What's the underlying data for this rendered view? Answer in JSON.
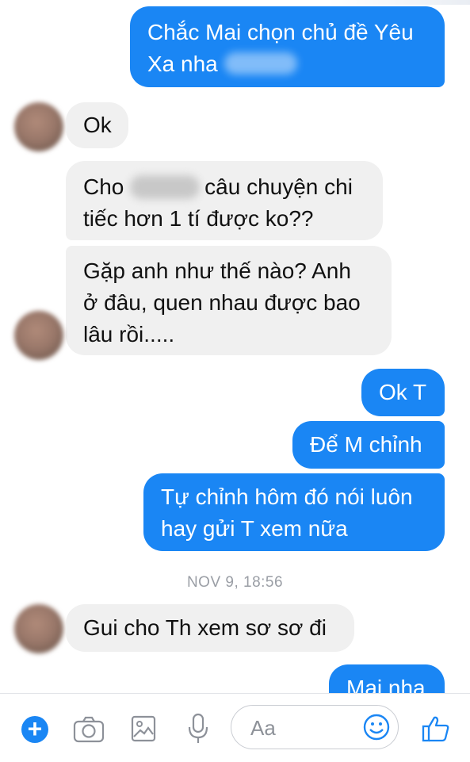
{
  "messages": [
    {
      "from": "me",
      "lines": [
        "Chắc Mai chọn chủ đề Yêu",
        "Xa nha"
      ]
    },
    {
      "from": "them",
      "lines": [
        "Ok"
      ]
    },
    {
      "from": "them",
      "lines": [
        "Cho",
        "câu chuyện chi",
        "tiếc hơn 1 tí được ko??"
      ]
    },
    {
      "from": "them",
      "lines": [
        "Gặp anh như thế nào? Anh",
        "ở đâu, quen nhau được bao",
        "lâu rồi....."
      ]
    },
    {
      "from": "me",
      "lines": [
        "Ok T"
      ]
    },
    {
      "from": "me",
      "lines": [
        "Để M chỉnh"
      ]
    },
    {
      "from": "me",
      "lines": [
        "Tự chỉnh hôm đó nói luôn",
        "hay gửi T xem nữa"
      ]
    },
    {
      "from": "them",
      "lines": [
        "Gui cho Th xem sơ sơ đi"
      ]
    },
    {
      "from": "me",
      "lines": [
        "Mai nha"
      ]
    }
  ],
  "timestamp": "NOV 9, 18:56",
  "composer": {
    "placeholder": "Aa"
  },
  "colors": {
    "outgoing_bubble": "#1a86f4",
    "incoming_bubble": "#f0f0f0",
    "accent": "#1a86f4"
  },
  "icons": [
    "plus-icon",
    "camera-icon",
    "image-icon",
    "microphone-icon",
    "emoji-icon",
    "thumbs-up-icon"
  ]
}
